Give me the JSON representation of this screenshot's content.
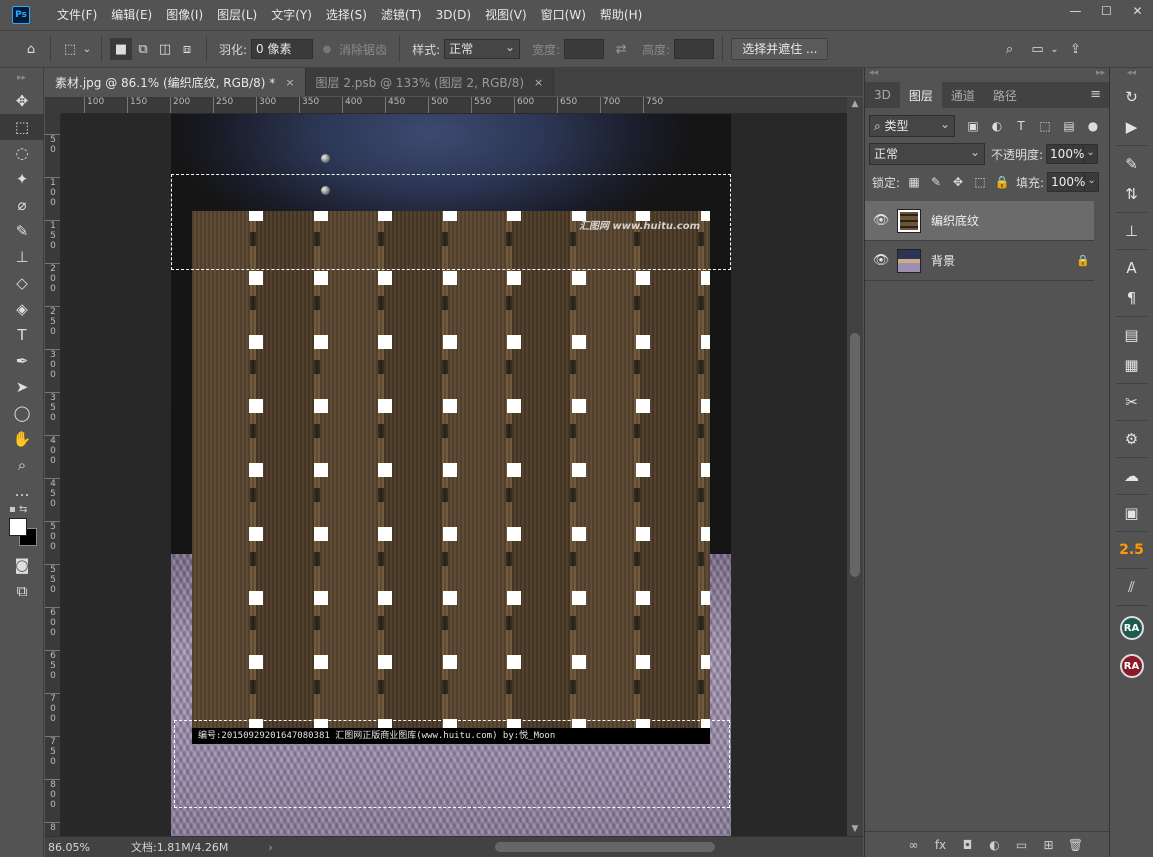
{
  "menubar": {
    "logo": "Ps",
    "items": [
      "文件(F)",
      "编辑(E)",
      "图像(I)",
      "图层(L)",
      "文字(Y)",
      "选择(S)",
      "滤镜(T)",
      "3D(D)",
      "视图(V)",
      "窗口(W)",
      "帮助(H)"
    ],
    "window_controls": [
      "—",
      "☐",
      "✕"
    ]
  },
  "options": {
    "feather_label": "羽化:",
    "feather_value": "0 像素",
    "antialias_label": "消除锯齿",
    "style_label": "样式:",
    "style_value": "正常",
    "width_label": "宽度:",
    "height_label": "高度:",
    "select_mask_button": "选择并遮住 ..."
  },
  "tabs": [
    {
      "label": "素材.jpg @ 86.1% (编织底纹, RGB/8) *",
      "close": "×"
    },
    {
      "label": "图层 2.psb @ 133% (图层 2, RGB/8)",
      "close": "×"
    }
  ],
  "ruler_h": [
    "100",
    "150",
    "200",
    "250",
    "300",
    "350",
    "400",
    "450",
    "500",
    "550",
    "600",
    "650",
    "700",
    "750"
  ],
  "ruler_v": [
    "5\n0",
    "1\n0\n0",
    "1\n5\n0",
    "2\n0\n0",
    "2\n5\n0",
    "3\n0\n0",
    "3\n5\n0",
    "4\n0\n0",
    "4\n5\n0",
    "5\n0\n0",
    "5\n5\n0",
    "6\n0\n0",
    "6\n5\n0",
    "7\n0\n0",
    "7\n5\n0",
    "8\n0\n0",
    "8"
  ],
  "canvas": {
    "watermark": "汇图网 www.huitu.com",
    "caption": "编号:20150929201647080381  汇图网正版商业图库(www.huitu.com)  by:悦_Moon"
  },
  "status": {
    "zoom": "86.05%",
    "doc_info": "文档:1.81M/4.26M",
    "arrow": "›"
  },
  "panel": {
    "tabs": [
      "3D",
      "图层",
      "通道",
      "路径"
    ],
    "active_tab": "图层",
    "filter_type": "类型",
    "blend_mode": "正常",
    "opacity_label": "不透明度:",
    "opacity_value": "100%",
    "lock_label": "锁定:",
    "fill_label": "填充:",
    "fill_value": "100%",
    "layers": [
      {
        "name": "编织底纹",
        "selected": true,
        "locked": false
      },
      {
        "name": "背景",
        "selected": false,
        "locked": true
      }
    ]
  },
  "dock": {
    "badge_25": "2.5",
    "ra_1": "RA",
    "ra_2": "RA"
  },
  "colors": {
    "foreground": "#ffffff",
    "background": "#000000",
    "dock_ra_1": "#1d5a4f",
    "dock_ra_2": "#8a1a2a"
  }
}
